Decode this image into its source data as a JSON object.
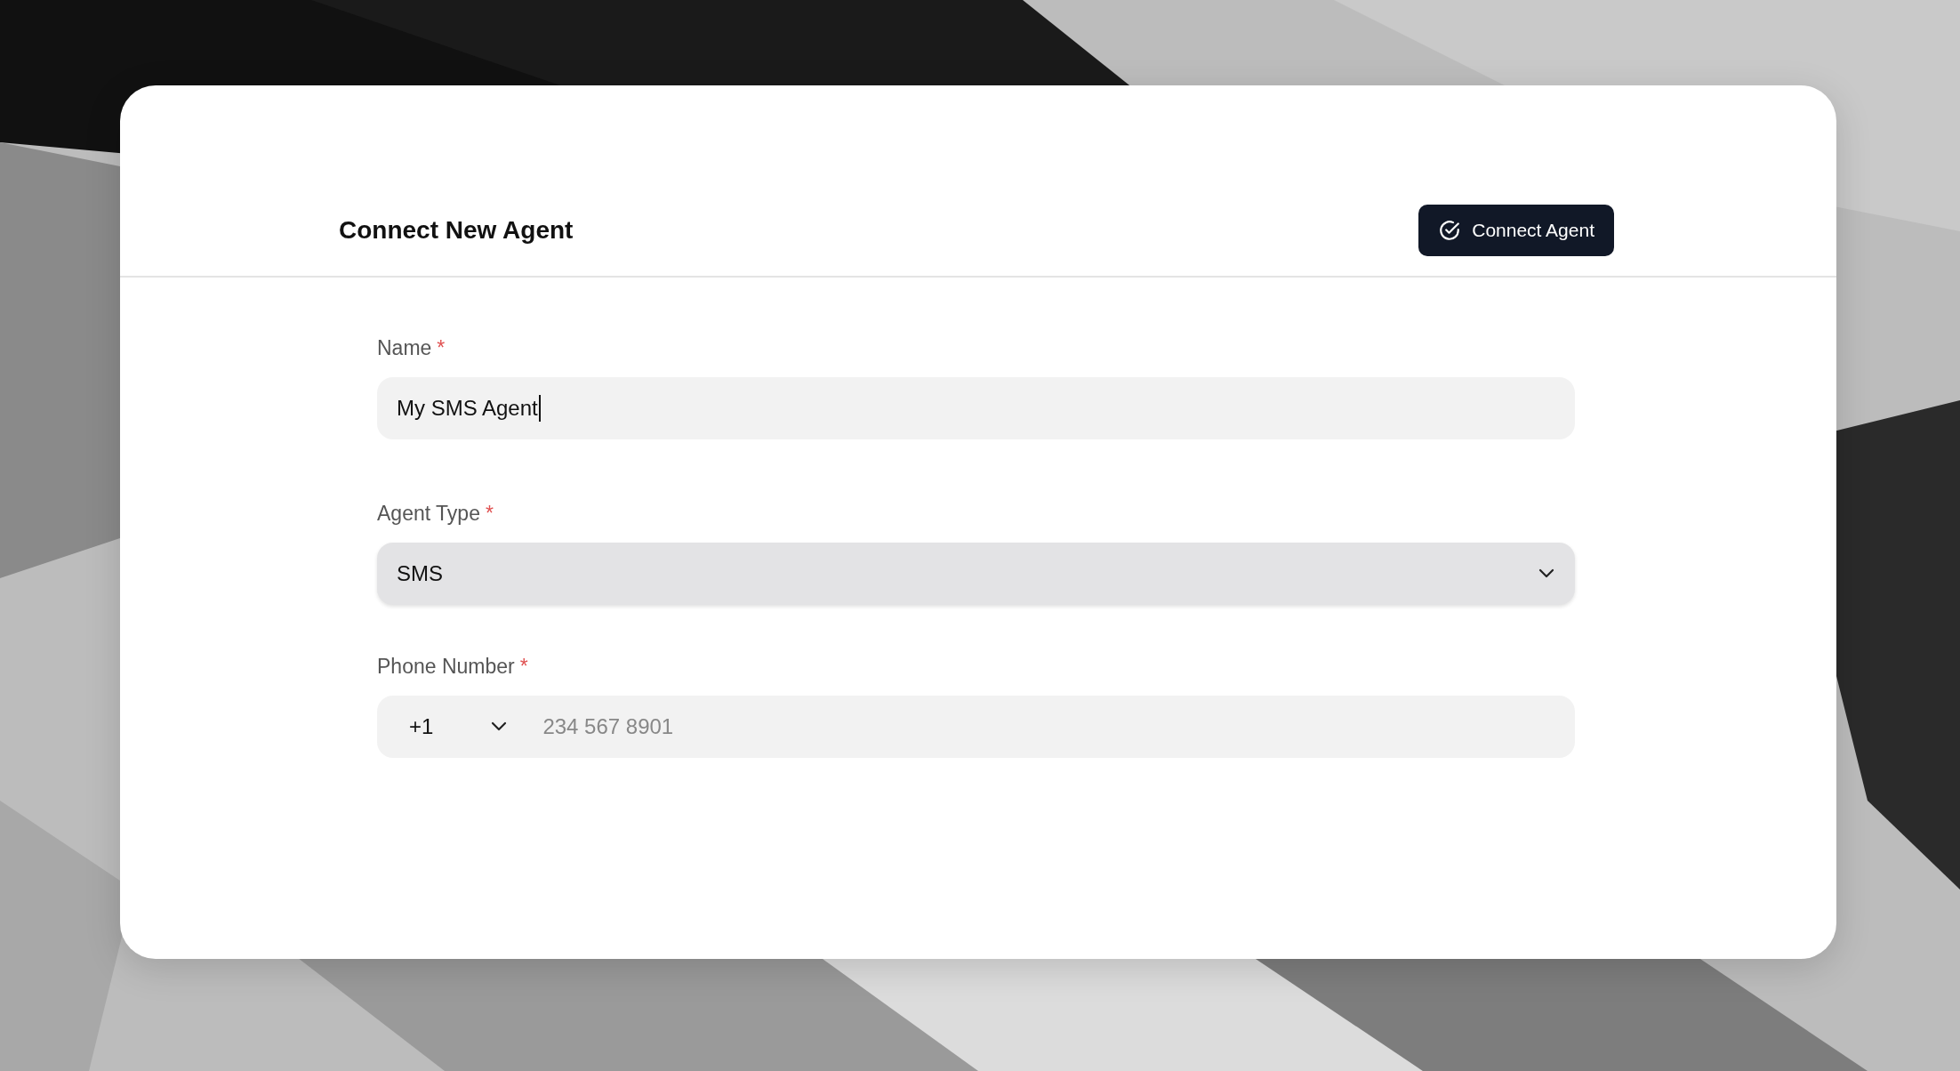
{
  "header": {
    "title": "Connect New Agent",
    "button": "Connect Agent"
  },
  "fields": [
    {
      "kind": "text",
      "label": "Name",
      "required_mark": "*",
      "value": "My SMS Agent",
      "focused": true
    },
    {
      "kind": "select",
      "label": "Agent Type",
      "required_mark": "*",
      "value": "SMS"
    },
    {
      "kind": "phone",
      "label": "Phone Number",
      "required_mark": "*",
      "country_code": "+1",
      "placeholder": "234 567 8901"
    }
  ]
}
